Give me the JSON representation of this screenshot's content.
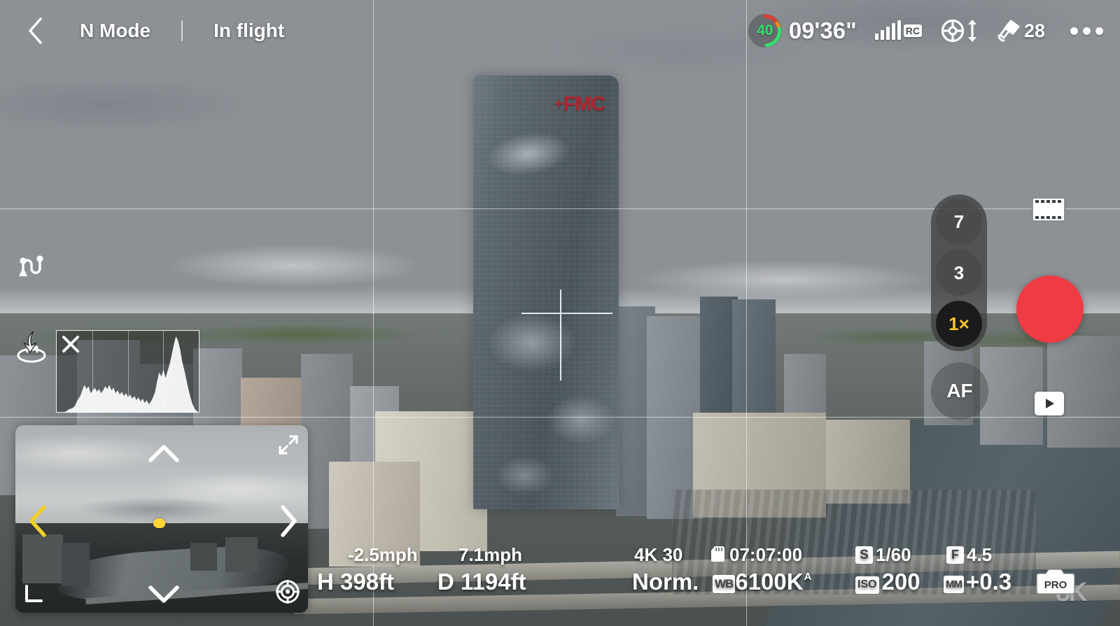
{
  "header": {
    "back_icon": "back-chevron-icon",
    "flight_mode": "N Mode",
    "flight_status": "In flight"
  },
  "status_bar": {
    "battery_percent": "40",
    "battery_color": "#32e06a",
    "flight_time": "09'36\"",
    "signal_icon": "signal-bars-icon",
    "rc_label": "RC",
    "gps_icon": "gps-lock-icon",
    "vertical_arrow_icon": "up-down-arrow-icon",
    "satellite_icon": "satellite-icon",
    "satellite_count": "28",
    "more_icon": "more-ellipsis-icon"
  },
  "left_rail": {
    "route_icon": "flight-route-icon",
    "return_home_icon": "return-to-home-icon"
  },
  "histogram": {
    "close_icon": "close-x-icon",
    "label": "histogram"
  },
  "minimap": {
    "expand_icon": "expand-arrows-icon",
    "left_chevron_icon": "chevron-left-icon",
    "right_chevron_icon": "chevron-right-icon",
    "up_chevron_icon": "chevron-up-icon",
    "down_chevron_icon": "chevron-down-icon",
    "corner_icon": "corner-bracket-icon",
    "compass_icon": "recenter-compass-icon",
    "marker_color": "#ffd633",
    "active_chevron_color": "#f0d02e"
  },
  "right_controls": {
    "zoom_levels": [
      {
        "label": "7",
        "active": false
      },
      {
        "label": "3",
        "active": false
      },
      {
        "label": "1×",
        "active": true
      }
    ],
    "focus_mode": "AF",
    "record_button": "record-button",
    "record_color": "#ef3b43",
    "video_mode_icon": "film-strip-icon",
    "playback_icon": "play-button-icon",
    "pro_camera_label": "PRO",
    "brand_mark": "8K"
  },
  "telemetry": {
    "vertical_speed": "-2.5mph",
    "horizontal_speed": "7.1mph",
    "height": "H 398ft",
    "distance": "D 1194ft"
  },
  "camera_osd": {
    "resolution_fps": "4K 30",
    "sd_icon": "sd-card-icon",
    "record_remaining": "07:07:00",
    "color_profile": "Norm.",
    "wb_tag": "WB",
    "wb_value": "6100K",
    "wb_auto_flag": "A",
    "shutter_tag": "S",
    "shutter_value": "1/60",
    "aperture_tag": "F",
    "aperture_value": "4.5",
    "iso_tag": "ISO",
    "iso_value": "200",
    "ev_tag": "MM",
    "ev_value": "+0.3"
  },
  "feed": {
    "building_logo": "FMC",
    "grid_overlay": "rule-of-thirds-grid",
    "center_crosshair": "center-crosshair"
  }
}
